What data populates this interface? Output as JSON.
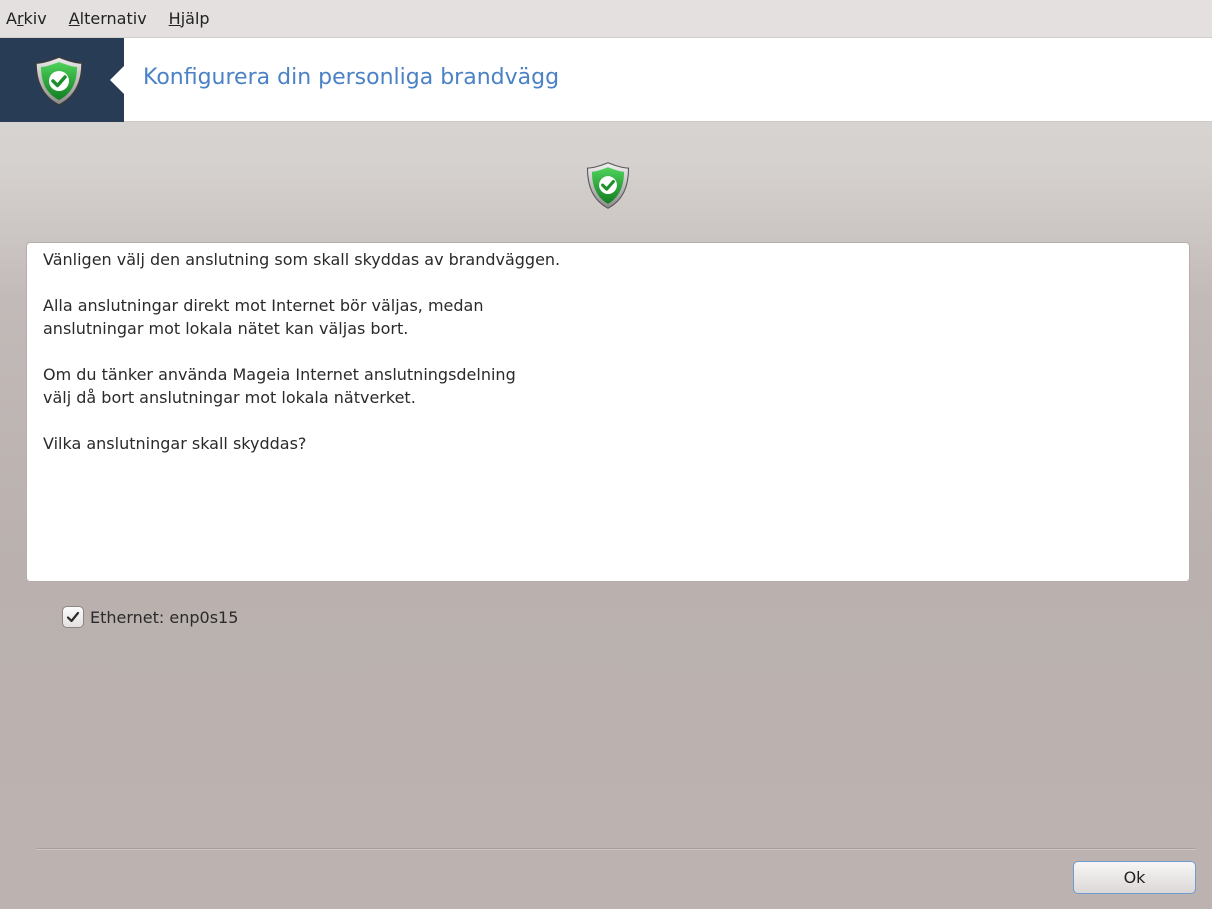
{
  "menubar": {
    "items": [
      {
        "pre": "A",
        "accel": "r",
        "post": "kiv"
      },
      {
        "pre": "",
        "accel": "A",
        "post": "lternativ"
      },
      {
        "pre": "",
        "accel": "H",
        "post": "jälp"
      }
    ]
  },
  "header": {
    "title": "Konfigurera din personliga brandvägg",
    "logo_icon": "shield-check-icon"
  },
  "colors": {
    "header_block": "#283c56",
    "title": "#4b82c6",
    "shield_green": "#22a636",
    "ok_border": "#6f9bcf"
  },
  "body": {
    "center_icon": "shield-check-icon",
    "lines": {
      "l1": "Vänligen välj den anslutning som skall skyddas av brandväggen.",
      "l2": "Alla anslutningar direkt mot Internet bör väljas, medan",
      "l3": "anslutningar mot lokala nätet kan väljas bort.",
      "l4": "Om du tänker använda Mageia Internet anslutningsdelning",
      "l5": "välj då bort anslutningar mot lokala nätverket.",
      "l6": "Vilka anslutningar skall skyddas?"
    }
  },
  "connections": [
    {
      "label": "Ethernet: enp0s15",
      "checked": true
    }
  ],
  "footer": {
    "ok_label": "Ok"
  }
}
